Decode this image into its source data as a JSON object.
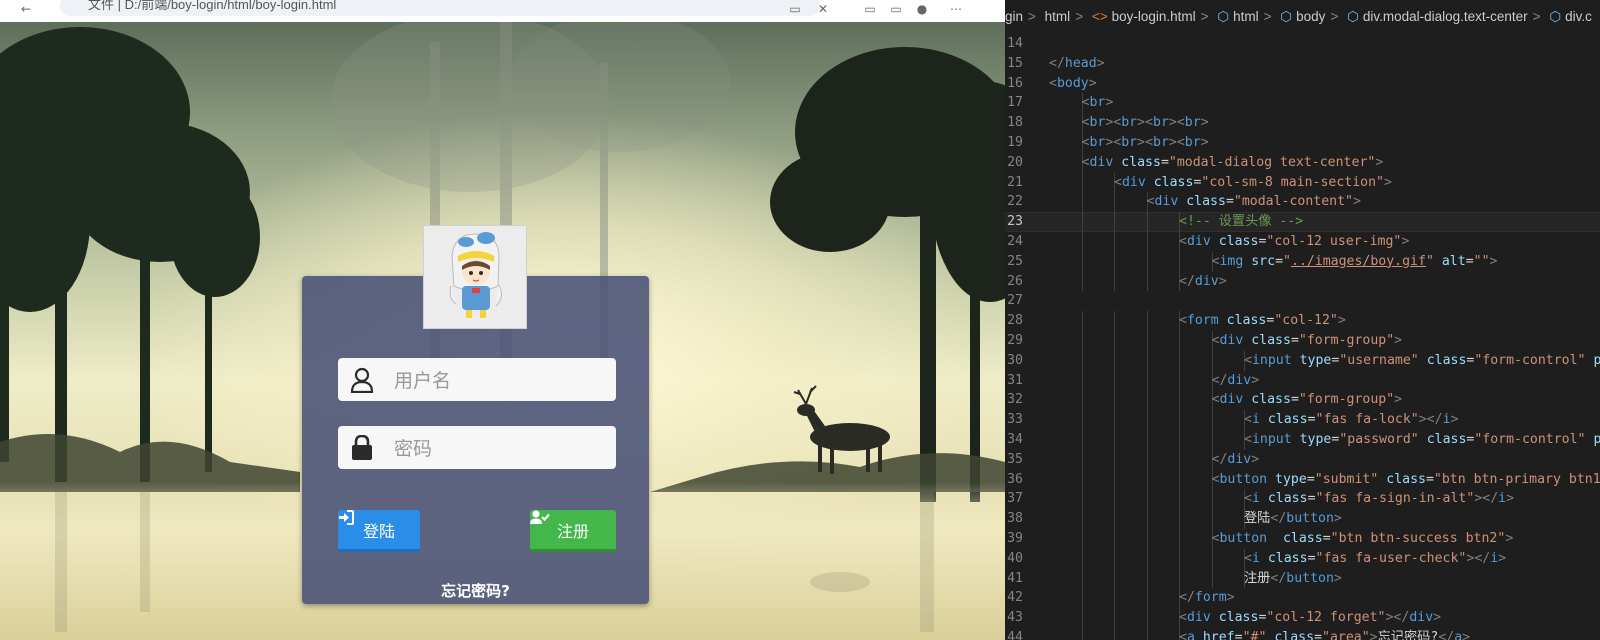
{
  "browser": {
    "address_text": "文件 | D:/前端/boy-login/html/boy-login.html",
    "page": {
      "username_placeholder": "用户名",
      "password_placeholder": "密码",
      "login_label": "登陆",
      "register_label": "注册",
      "forgot_link": "忘记密码?",
      "icons": {
        "username": "user-icon",
        "password": "lock-icon",
        "login": "sign-in-icon",
        "register": "user-check-icon",
        "avatar": "boy-avatar-image"
      },
      "colors": {
        "card": "#4c5478",
        "login_button": "#2a8ee8",
        "register_button": "#43b74a"
      }
    }
  },
  "editor": {
    "breadcrumbs": [
      "gin",
      "html",
      "boy-login.html",
      "html",
      "body",
      "div.modal-dialog.text-center",
      "div.c"
    ],
    "active_line": 23,
    "lines": [
      {
        "num": "14",
        "indent": 0,
        "tokens": []
      },
      {
        "num": "15",
        "indent": 1,
        "tokens": [
          [
            "t-br",
            "</"
          ],
          [
            "t-tag",
            "head"
          ],
          [
            "t-br",
            ">"
          ]
        ]
      },
      {
        "num": "16",
        "indent": 1,
        "tokens": [
          [
            "t-br",
            "<"
          ],
          [
            "t-tag",
            "body"
          ],
          [
            "t-br",
            ">"
          ]
        ]
      },
      {
        "num": "17",
        "indent": 2,
        "tokens": [
          [
            "t-br",
            "<"
          ],
          [
            "t-tag",
            "br"
          ],
          [
            "t-br",
            ">"
          ]
        ]
      },
      {
        "num": "18",
        "indent": 2,
        "tokens": [
          [
            "t-br",
            "<"
          ],
          [
            "t-tag",
            "br"
          ],
          [
            "t-br",
            "><"
          ],
          [
            "t-tag",
            "br"
          ],
          [
            "t-br",
            "><"
          ],
          [
            "t-tag",
            "br"
          ],
          [
            "t-br",
            "><"
          ],
          [
            "t-tag",
            "br"
          ],
          [
            "t-br",
            ">"
          ]
        ]
      },
      {
        "num": "19",
        "indent": 2,
        "tokens": [
          [
            "t-br",
            "<"
          ],
          [
            "t-tag",
            "br"
          ],
          [
            "t-br",
            "><"
          ],
          [
            "t-tag",
            "br"
          ],
          [
            "t-br",
            "><"
          ],
          [
            "t-tag",
            "br"
          ],
          [
            "t-br",
            "><"
          ],
          [
            "t-tag",
            "br"
          ],
          [
            "t-br",
            ">"
          ]
        ]
      },
      {
        "num": "20",
        "indent": 2,
        "tokens": [
          [
            "t-br",
            "<"
          ],
          [
            "t-tag",
            "div"
          ],
          [
            "t-txt",
            " "
          ],
          [
            "t-attr",
            "class"
          ],
          [
            "t-txt",
            "="
          ],
          [
            "t-str",
            "\"modal-dialog text-center\""
          ],
          [
            "t-br",
            ">"
          ]
        ]
      },
      {
        "num": "21",
        "indent": 3,
        "tokens": [
          [
            "t-br",
            "<"
          ],
          [
            "t-tag",
            "div"
          ],
          [
            "t-txt",
            " "
          ],
          [
            "t-attr",
            "class"
          ],
          [
            "t-txt",
            "="
          ],
          [
            "t-str",
            "\"col-sm-8 main-section\""
          ],
          [
            "t-br",
            ">"
          ]
        ]
      },
      {
        "num": "22",
        "indent": 4,
        "tokens": [
          [
            "t-br",
            "<"
          ],
          [
            "t-tag",
            "div"
          ],
          [
            "t-txt",
            " "
          ],
          [
            "t-attr",
            "class"
          ],
          [
            "t-txt",
            "="
          ],
          [
            "t-str",
            "\"modal-content\""
          ],
          [
            "t-br",
            ">"
          ]
        ]
      },
      {
        "num": "23",
        "indent": 5,
        "tokens": [
          [
            "t-cmt",
            "<!-- 设置头像 -->"
          ]
        ]
      },
      {
        "num": "24",
        "indent": 5,
        "tokens": [
          [
            "t-br",
            "<"
          ],
          [
            "t-tag",
            "div"
          ],
          [
            "t-txt",
            " "
          ],
          [
            "t-attr",
            "class"
          ],
          [
            "t-txt",
            "="
          ],
          [
            "t-str",
            "\"col-12 user-img\""
          ],
          [
            "t-br",
            ">"
          ]
        ]
      },
      {
        "num": "25",
        "indent": 6,
        "tokens": [
          [
            "t-br",
            "<"
          ],
          [
            "t-tag",
            "img"
          ],
          [
            "t-txt",
            " "
          ],
          [
            "t-attr",
            "src"
          ],
          [
            "t-txt",
            "="
          ],
          [
            "t-str",
            "\""
          ],
          [
            "t-str t-link",
            "../images/boy.gif"
          ],
          [
            "t-str",
            "\""
          ],
          [
            "t-txt",
            " "
          ],
          [
            "t-attr",
            "alt"
          ],
          [
            "t-txt",
            "="
          ],
          [
            "t-str",
            "\"\""
          ],
          [
            "t-br",
            ">"
          ]
        ]
      },
      {
        "num": "26",
        "indent": 5,
        "tokens": [
          [
            "t-br",
            "</"
          ],
          [
            "t-tag",
            "div"
          ],
          [
            "t-br",
            ">"
          ]
        ]
      },
      {
        "num": "27",
        "indent": 0,
        "tokens": []
      },
      {
        "num": "28",
        "indent": 5,
        "tokens": [
          [
            "t-br",
            "<"
          ],
          [
            "t-tag",
            "form"
          ],
          [
            "t-txt",
            " "
          ],
          [
            "t-attr",
            "class"
          ],
          [
            "t-txt",
            "="
          ],
          [
            "t-str",
            "\"col-12\""
          ],
          [
            "t-br",
            ">"
          ]
        ]
      },
      {
        "num": "29",
        "indent": 6,
        "tokens": [
          [
            "t-br",
            "<"
          ],
          [
            "t-tag",
            "div"
          ],
          [
            "t-txt",
            " "
          ],
          [
            "t-attr",
            "class"
          ],
          [
            "t-txt",
            "="
          ],
          [
            "t-str",
            "\"form-group\""
          ],
          [
            "t-br",
            ">"
          ]
        ]
      },
      {
        "num": "30",
        "indent": 7,
        "tokens": [
          [
            "t-br",
            "<"
          ],
          [
            "t-tag",
            "input"
          ],
          [
            "t-txt",
            " "
          ],
          [
            "t-attr",
            "type"
          ],
          [
            "t-txt",
            "="
          ],
          [
            "t-str",
            "\"username\""
          ],
          [
            "t-txt",
            " "
          ],
          [
            "t-attr",
            "class"
          ],
          [
            "t-txt",
            "="
          ],
          [
            "t-str",
            "\"form-control\""
          ],
          [
            "t-txt",
            " "
          ],
          [
            "t-attr",
            "p"
          ]
        ]
      },
      {
        "num": "31",
        "indent": 6,
        "tokens": [
          [
            "t-br",
            "</"
          ],
          [
            "t-tag",
            "div"
          ],
          [
            "t-br",
            ">"
          ]
        ]
      },
      {
        "num": "32",
        "indent": 6,
        "tokens": [
          [
            "t-br",
            "<"
          ],
          [
            "t-tag",
            "div"
          ],
          [
            "t-txt",
            " "
          ],
          [
            "t-attr",
            "class"
          ],
          [
            "t-txt",
            "="
          ],
          [
            "t-str",
            "\"form-group\""
          ],
          [
            "t-br",
            ">"
          ]
        ]
      },
      {
        "num": "33",
        "indent": 7,
        "tokens": [
          [
            "t-br",
            "<"
          ],
          [
            "t-tag",
            "i"
          ],
          [
            "t-txt",
            " "
          ],
          [
            "t-attr",
            "class"
          ],
          [
            "t-txt",
            "="
          ],
          [
            "t-str",
            "\"fas fa-lock\""
          ],
          [
            "t-br",
            "></"
          ],
          [
            "t-tag",
            "i"
          ],
          [
            "t-br",
            ">"
          ]
        ]
      },
      {
        "num": "34",
        "indent": 7,
        "tokens": [
          [
            "t-br",
            "<"
          ],
          [
            "t-tag",
            "input"
          ],
          [
            "t-txt",
            " "
          ],
          [
            "t-attr",
            "type"
          ],
          [
            "t-txt",
            "="
          ],
          [
            "t-str",
            "\"password\""
          ],
          [
            "t-txt",
            " "
          ],
          [
            "t-attr",
            "class"
          ],
          [
            "t-txt",
            "="
          ],
          [
            "t-str",
            "\"form-control\""
          ],
          [
            "t-txt",
            " "
          ],
          [
            "t-attr",
            "p"
          ]
        ]
      },
      {
        "num": "35",
        "indent": 6,
        "tokens": [
          [
            "t-br",
            "</"
          ],
          [
            "t-tag",
            "div"
          ],
          [
            "t-br",
            ">"
          ]
        ]
      },
      {
        "num": "36",
        "indent": 6,
        "tokens": [
          [
            "t-br",
            "<"
          ],
          [
            "t-tag",
            "button"
          ],
          [
            "t-txt",
            " "
          ],
          [
            "t-attr",
            "type"
          ],
          [
            "t-txt",
            "="
          ],
          [
            "t-str",
            "\"submit\""
          ],
          [
            "t-txt",
            " "
          ],
          [
            "t-attr",
            "class"
          ],
          [
            "t-txt",
            "="
          ],
          [
            "t-str",
            "\"btn btn-primary btn1"
          ]
        ]
      },
      {
        "num": "37",
        "indent": 7,
        "tokens": [
          [
            "t-br",
            "<"
          ],
          [
            "t-tag",
            "i"
          ],
          [
            "t-txt",
            " "
          ],
          [
            "t-attr",
            "class"
          ],
          [
            "t-txt",
            "="
          ],
          [
            "t-str",
            "\"fas fa-sign-in-alt\""
          ],
          [
            "t-br",
            "></"
          ],
          [
            "t-tag",
            "i"
          ],
          [
            "t-br",
            ">"
          ]
        ]
      },
      {
        "num": "38",
        "indent": 7,
        "tokens": [
          [
            "t-txt",
            "登陆"
          ],
          [
            "t-br",
            "</"
          ],
          [
            "t-tag",
            "button"
          ],
          [
            "t-br",
            ">"
          ]
        ]
      },
      {
        "num": "39",
        "indent": 6,
        "tokens": [
          [
            "t-br",
            "<"
          ],
          [
            "t-tag",
            "button"
          ],
          [
            "t-txt",
            "  "
          ],
          [
            "t-attr",
            "class"
          ],
          [
            "t-txt",
            "="
          ],
          [
            "t-str",
            "\"btn btn-success btn2\""
          ],
          [
            "t-br",
            ">"
          ]
        ]
      },
      {
        "num": "40",
        "indent": 7,
        "tokens": [
          [
            "t-br",
            "<"
          ],
          [
            "t-tag",
            "i"
          ],
          [
            "t-txt",
            " "
          ],
          [
            "t-attr",
            "class"
          ],
          [
            "t-txt",
            "="
          ],
          [
            "t-str",
            "\"fas fa-user-check\""
          ],
          [
            "t-br",
            "></"
          ],
          [
            "t-tag",
            "i"
          ],
          [
            "t-br",
            ">"
          ]
        ]
      },
      {
        "num": "41",
        "indent": 7,
        "tokens": [
          [
            "t-txt",
            "注册"
          ],
          [
            "t-br",
            "</"
          ],
          [
            "t-tag",
            "button"
          ],
          [
            "t-br",
            ">"
          ]
        ]
      },
      {
        "num": "42",
        "indent": 5,
        "tokens": [
          [
            "t-br",
            "</"
          ],
          [
            "t-tag",
            "form"
          ],
          [
            "t-br",
            ">"
          ]
        ]
      },
      {
        "num": "43",
        "indent": 5,
        "tokens": [
          [
            "t-br",
            "<"
          ],
          [
            "t-tag",
            "div"
          ],
          [
            "t-txt",
            " "
          ],
          [
            "t-attr",
            "class"
          ],
          [
            "t-txt",
            "="
          ],
          [
            "t-str",
            "\"col-12 forget\""
          ],
          [
            "t-br",
            "></"
          ],
          [
            "t-tag",
            "div"
          ],
          [
            "t-br",
            ">"
          ]
        ]
      },
      {
        "num": "44",
        "indent": 5,
        "tokens": [
          [
            "t-br",
            "<"
          ],
          [
            "t-tag",
            "a"
          ],
          [
            "t-txt",
            " "
          ],
          [
            "t-attr",
            "href"
          ],
          [
            "t-txt",
            "="
          ],
          [
            "t-str",
            "\"#\""
          ],
          [
            "t-txt",
            " "
          ],
          [
            "t-attr",
            "class"
          ],
          [
            "t-txt",
            "="
          ],
          [
            "t-str",
            "\"area\""
          ],
          [
            "t-br",
            ">"
          ],
          [
            "t-txt",
            "忘记密码?"
          ],
          [
            "t-br",
            "</"
          ],
          [
            "t-tag",
            "a"
          ],
          [
            "t-br",
            ">"
          ]
        ]
      }
    ]
  }
}
